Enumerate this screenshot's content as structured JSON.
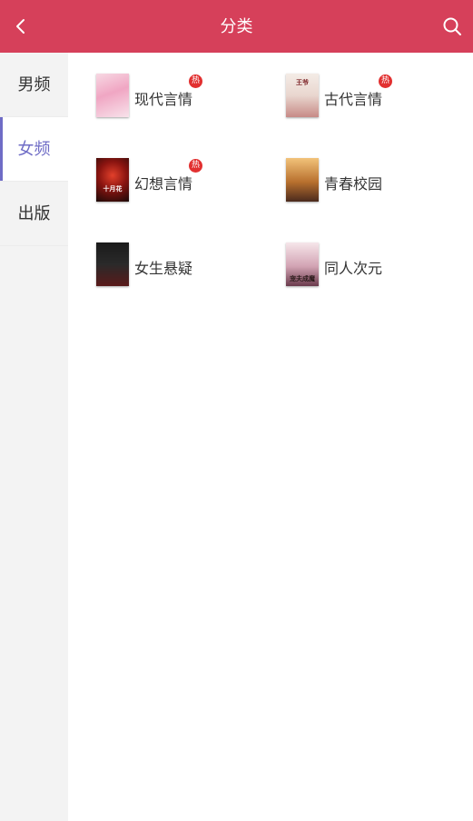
{
  "header": {
    "title": "分类",
    "back_icon": "back-arrow-icon",
    "search_icon": "search-icon",
    "background": "#d6405a"
  },
  "sidebar": {
    "items": [
      {
        "label": "男频",
        "active": false
      },
      {
        "label": "女频",
        "active": true
      },
      {
        "label": "出版",
        "active": false
      }
    ],
    "active_color": "#6f6cc6"
  },
  "categories": [
    {
      "label": "现代言情",
      "hot": true,
      "hot_label": "热"
    },
    {
      "label": "古代言情",
      "hot": true,
      "hot_label": "热"
    },
    {
      "label": "幻想言情",
      "hot": true,
      "hot_label": "热"
    },
    {
      "label": "青春校园",
      "hot": false
    },
    {
      "label": "女生悬疑",
      "hot": false
    },
    {
      "label": "同人次元",
      "hot": false
    }
  ],
  "covers": [
    {
      "text": ""
    },
    {
      "text": "王爷"
    },
    {
      "text": "十月花"
    },
    {
      "text": ""
    },
    {
      "text": ""
    },
    {
      "text": "宠夫成魔"
    }
  ]
}
